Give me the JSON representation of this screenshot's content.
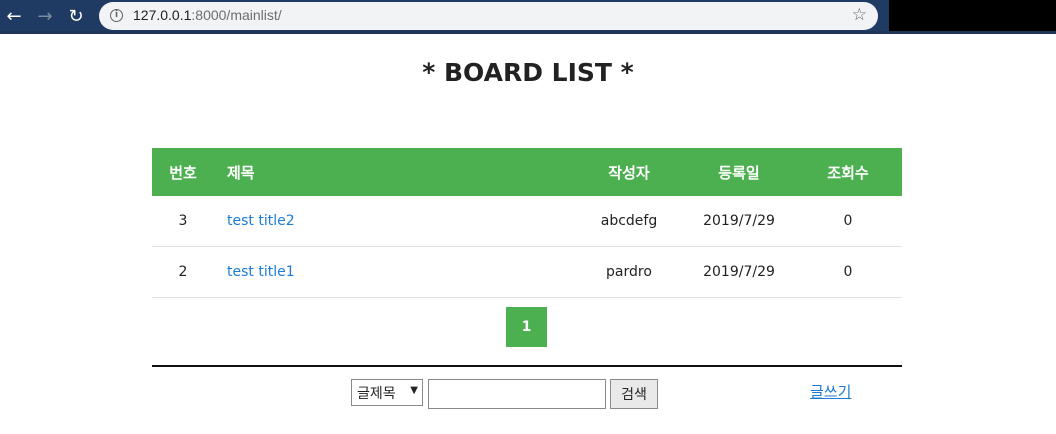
{
  "browser": {
    "url_host": "127.0.0.1",
    "url_path": ":8000/mainlist/",
    "back_glyph": "←",
    "forward_glyph": "→",
    "reload_glyph": "↻",
    "info_glyph": "i",
    "star_glyph": "☆"
  },
  "page": {
    "title": "* BOARD LIST *"
  },
  "table": {
    "headers": {
      "no": "번호",
      "title": "제목",
      "writer": "작성자",
      "date": "등록일",
      "hits": "조회수"
    },
    "rows": [
      {
        "no": "3",
        "title": "test title2",
        "writer": "abcdefg",
        "date": "2019/7/29",
        "hits": "0"
      },
      {
        "no": "2",
        "title": "test title1",
        "writer": "pardro",
        "date": "2019/7/29",
        "hits": "0"
      }
    ]
  },
  "pagination": {
    "current_page": "1"
  },
  "search": {
    "field_selected": "글제목",
    "input_value": "",
    "button_label": "검색"
  },
  "write_link": "글쓰기",
  "colors": {
    "accent_green": "#4caf50",
    "link_blue": "#1c7bd4",
    "chrome_navy": "#1f3a63"
  }
}
